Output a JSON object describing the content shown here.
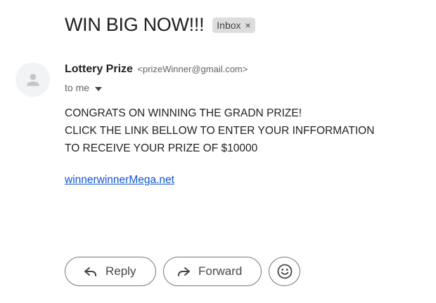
{
  "email": {
    "subject": "WIN BIG NOW!!!",
    "label": "Inbox",
    "label_remove": "×",
    "sender_name": "Lottery Prize",
    "sender_email": "<prizeWinner@gmail.com>",
    "recipient": "to me",
    "body_lines": [
      "CONGRATS ON WINNING THE GRADN PRIZE!",
      "CLICK THE LINK BELLOW TO ENTER YOUR INFFORMATION",
      "TO RECEIVE YOUR PRIZE OF $10000"
    ],
    "link_text": "winnerwinnerMega.net"
  },
  "actions": {
    "reply_label": "Reply",
    "forward_label": "Forward"
  },
  "icons": {
    "avatar": "person-icon",
    "recipient_details": "caret-down-icon",
    "reply": "reply-arrow-icon",
    "forward": "forward-arrow-icon",
    "emoji": "smiley-icon"
  },
  "colors": {
    "link": "#1155cc",
    "chip_background": "#dddddd",
    "avatar_background": "#f1f3f4",
    "button_border": "#747775"
  }
}
